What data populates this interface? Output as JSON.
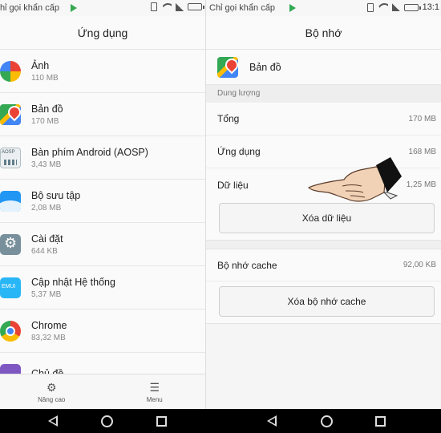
{
  "left": {
    "status": {
      "carrier": "Chỉ gọi khẩn cấp"
    },
    "title": "Ứng dụng",
    "apps": [
      {
        "name": "Ảnh",
        "size": "110 MB",
        "icon": "photos-icon"
      },
      {
        "name": "Bản đồ",
        "size": "170 MB",
        "icon": "maps-icon"
      },
      {
        "name": "Bàn phím Android (AOSP)",
        "size": "3,43 MB",
        "icon": "keyboard-icon"
      },
      {
        "name": "Bộ sưu tập",
        "size": "2,08 MB",
        "icon": "gallery-icon"
      },
      {
        "name": "Cài đặt",
        "size": "644 KB",
        "icon": "settings-icon"
      },
      {
        "name": "Cập nhật Hệ thống",
        "size": "5,37 MB",
        "icon": "system-update-icon"
      },
      {
        "name": "Chrome",
        "size": "83,32 MB",
        "icon": "chrome-icon"
      },
      {
        "name": "Chủ đề",
        "size": "",
        "icon": "themes-icon"
      }
    ],
    "bottom_bar": {
      "advanced_label": "Nâng cao",
      "menu_label": "Menu"
    }
  },
  "right": {
    "status": {
      "carrier": "Chỉ gọi khẩn cấp",
      "time": "13:1"
    },
    "title": "Bộ nhớ",
    "app_name": "Bản đồ",
    "section_label": "Dung lượng",
    "rows": [
      {
        "label": "Tổng",
        "value": "170 MB"
      },
      {
        "label": "Ứng dụng",
        "value": "168 MB"
      },
      {
        "label": "Dữ liệu",
        "value": "1,25 MB"
      }
    ],
    "clear_data_label": "Xóa dữ liệu",
    "cache_label": "Bộ nhớ cache",
    "cache_value": "92,00 KB",
    "clear_cache_label": "Xóa bộ nhớ cache"
  },
  "colors": {
    "play_store_green": "#34a853",
    "navbar": "#000000"
  }
}
